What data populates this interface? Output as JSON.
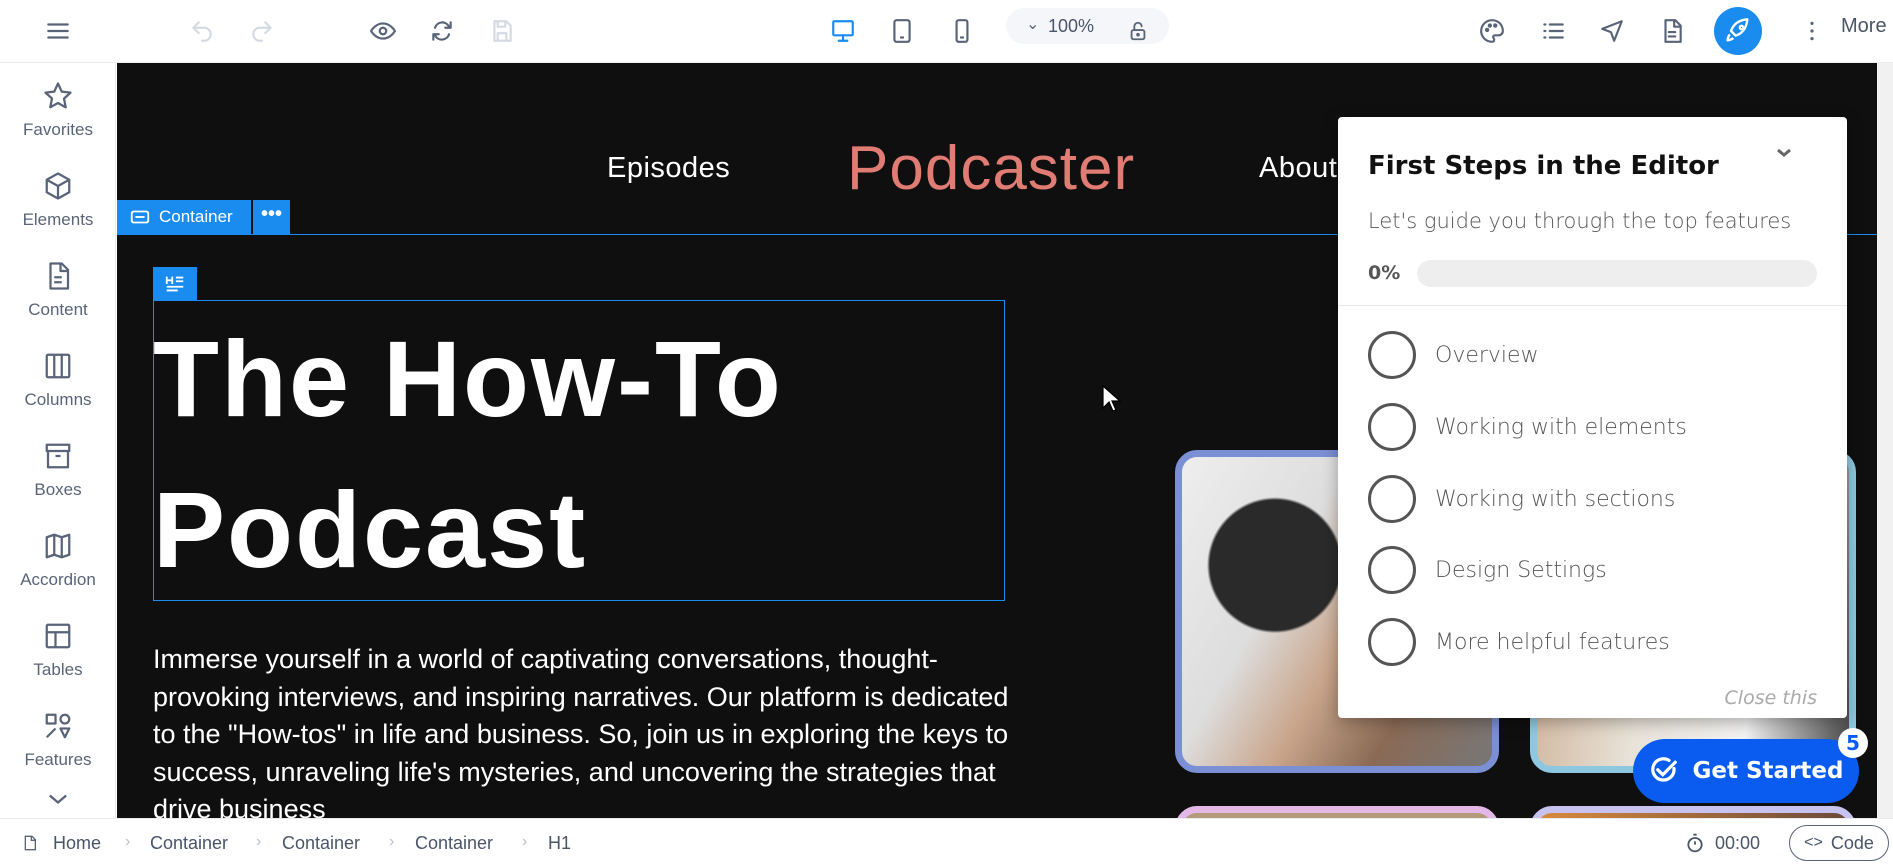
{
  "toolbar": {
    "zoom": "100%",
    "more": "More",
    "accent": "#1a8cf0",
    "icons": [
      "menu-icon",
      "undo-icon",
      "redo-icon",
      "eye-icon",
      "refresh-icon",
      "save-icon",
      "desktop-icon",
      "tablet-icon",
      "mobile-icon",
      "lock-icon",
      "palette-icon",
      "list-icon",
      "send-icon",
      "document-icon",
      "rocket-icon",
      "more-vertical-icon"
    ]
  },
  "sidebar": {
    "items": [
      {
        "label": "Favorites"
      },
      {
        "label": "Elements"
      },
      {
        "label": "Content"
      },
      {
        "label": "Columns"
      },
      {
        "label": "Boxes"
      },
      {
        "label": "Accordion"
      },
      {
        "label": "Tables"
      },
      {
        "label": "Features"
      }
    ]
  },
  "site": {
    "nav": {
      "episodes": "Episodes",
      "brand": "Podcaster",
      "about": "About"
    },
    "container_label": "Container",
    "h1": "The How-To Podcast",
    "paragraph": "Immerse yourself in a world of captivating conversations, thought-provoking interviews, and inspiring narratives. Our platform is dedicated to the \"How-tos\" in life and business. So, join us in exploring the keys to success, unraveling life's mysteries, and uncovering the strategies that drive business"
  },
  "guide": {
    "title": "First Steps in the Editor",
    "subtitle": "Let's guide you through the top features",
    "progress_label": "0%",
    "progress": 0,
    "steps": [
      {
        "label": "Overview"
      },
      {
        "label": "Working with elements"
      },
      {
        "label": "Working with sections"
      },
      {
        "label": "Design Settings"
      },
      {
        "label": "More helpful features"
      }
    ],
    "close": "Close this",
    "cta": "Get Started",
    "badge": "5"
  },
  "bottombar": {
    "breadcrumb": [
      "Home",
      "Container",
      "Container",
      "Container",
      "H1"
    ],
    "timer": "00:00",
    "code": "Code"
  }
}
